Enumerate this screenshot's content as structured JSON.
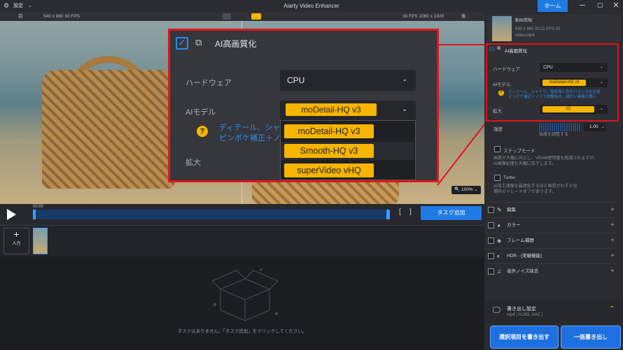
{
  "titlebar": {
    "settings_label": "設定",
    "app_title": "Aiarty Video Enhancer",
    "home_label": "ホーム",
    "minimize": "─",
    "maximize": "☐",
    "close": "✕"
  },
  "infobar": {
    "before_label": "前",
    "before_info": "540 x 960   30 FPS",
    "after_info": "30 FPS   1080 x 1920",
    "after_label": "後"
  },
  "preview": {
    "zoom": "100%"
  },
  "popup": {
    "title": "AI高画質化",
    "hardware_label": "ハードウェア",
    "hardware_value": "CPU",
    "model_label": "AIモデル",
    "model_value": "moDetail-HQ  v3",
    "hint_mark": "?",
    "hint_text_1": "ディテール、シャ",
    "hint_text_2": "ピンボケ補正＋ノ",
    "scale_label": "拡大",
    "options": [
      "moDetail-HQ  v3",
      "Smooth-HQ  v3",
      "superVideo vHQ"
    ]
  },
  "player": {
    "time": "00:00",
    "task_button": "タスク追加"
  },
  "clips": {
    "add_label": "入力",
    "add_plus": "+"
  },
  "tasks": {
    "empty_message": "タスクはありません。「タスク追加」をクリックしてください。"
  },
  "rpanel": {
    "video_info": [
      "動画情報:",
      "540 x 960  00:11  FPS 30",
      "video.mp4"
    ],
    "ai_title": "AI高画質化",
    "hardware_label": "ハードウェア",
    "hardware_value": "CPU",
    "model_label": "AIモデル",
    "model_value": "moDetail-HQ  v3",
    "hint_mark": "?",
    "hint_1": "ディテール、シャドウ、陰影面と色のバランスを生成",
    "hint_2": "ピンボケ補正＋ノイズ調整除去、細かい画像の職人",
    "scale_label": "拡大",
    "scale_value": "x2",
    "strength_label": "強度",
    "strength_value": "1.00",
    "strength_sub": "強度を調整する",
    "step_label": "ステップモード",
    "step_desc_1": "画質が大幅に向上し、VRAM使用量も削減されますが、",
    "step_desc_2": "AI画像処理も大幅に低下します。",
    "turbo_label": "Turbo",
    "turbo_desc_1": "AI加工速度を最適化するほど画質がわずかな",
    "turbo_desc_2": "場所のトレードオフがあります。",
    "sections": [
      "編集",
      "カラー",
      "フレーム補間",
      "HDR - (実験機能)",
      "音声ノイズ除去"
    ],
    "export_label": "書き出し設定",
    "export_format": "mp4 | H.265, AAC |",
    "export_selected": "選択項目を書き出す",
    "export_all": "一括書き出し"
  }
}
